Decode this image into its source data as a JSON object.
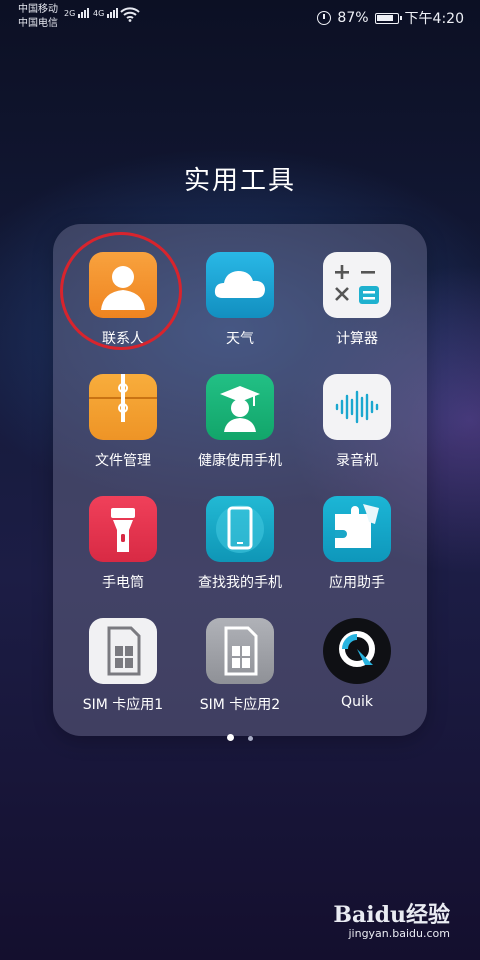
{
  "status": {
    "carrier1": "中国移动",
    "carrier2": "中国电信",
    "net1": "2G",
    "net2": "4G",
    "battery_percent": "87%",
    "battery_level": 0.87,
    "time": "下午4:20"
  },
  "folder": {
    "title": "实用工具",
    "apps": [
      {
        "label": "联系人",
        "icon": "contacts-icon",
        "color": "#f5922b"
      },
      {
        "label": "天气",
        "icon": "weather-cloud-icon",
        "color": "#1fa6d6"
      },
      {
        "label": "计算器",
        "icon": "calculator-icon",
        "color": "#f2f2f4"
      },
      {
        "label": "文件管理",
        "icon": "file-manager-icon",
        "color": "#f2a12c"
      },
      {
        "label": "健康使用手机",
        "icon": "graduation-cap-icon",
        "color": "#1bb37a"
      },
      {
        "label": "录音机",
        "icon": "sound-wave-icon",
        "color": "#f2f2f4"
      },
      {
        "label": "手电筒",
        "icon": "flashlight-icon",
        "color": "#e9334b"
      },
      {
        "label": "查找我的手机",
        "icon": "find-phone-icon",
        "color": "#17a9c6"
      },
      {
        "label": "应用助手",
        "icon": "puzzle-icon",
        "color": "#12a9c9"
      },
      {
        "label": "SIM 卡应用1",
        "icon": "sim-card-icon",
        "color": "#f0f0f2"
      },
      {
        "label": "SIM 卡应用2",
        "icon": "sim-card-icon",
        "color": "#9fa1a8"
      },
      {
        "label": "Quik",
        "icon": "quik-logo-icon",
        "color": "#101014"
      }
    ],
    "current_page": 1,
    "page_count": 2
  },
  "watermark": {
    "brand": "Baidu经验",
    "url": "jingyan.baidu.com"
  }
}
